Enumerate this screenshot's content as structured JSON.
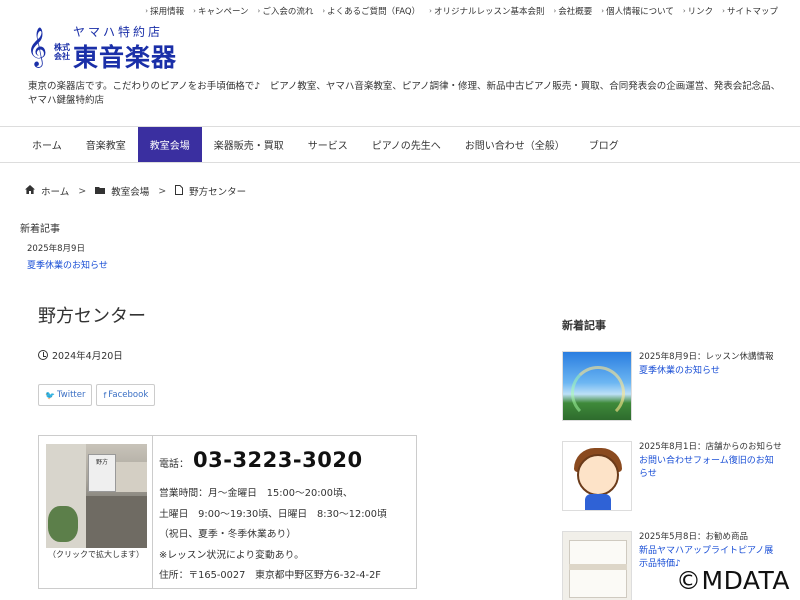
{
  "top_menu": [
    "採用情報",
    "キャンペーン",
    "ご入会の流れ",
    "よくあるご質問（FAQ）",
    "オリジナルレッスン基本会則",
    "会社概要",
    "個人情報について",
    "リンク",
    "サイトマップ"
  ],
  "logo": {
    "sub": "ヤマハ特約店",
    "corp_line1": "株式",
    "corp_line2": "会社",
    "name": "東音楽器"
  },
  "tagline": "東京の楽器店です。こだわりのピアノをお手頃価格で♪　ピアノ教室、ヤマハ音楽教室、ピアノ調律・修理、新品中古ピアノ販売・買取、合同発表会の企画運営、発表会記念品、ヤマハ鍵盤特約店",
  "nav": {
    "items": [
      "ホーム",
      "音楽教室",
      "教室会場",
      "楽器販売・買取",
      "サービス",
      "ピアノの先生へ",
      "お問い合わせ（全般）",
      "ブログ"
    ],
    "active": "教室会場"
  },
  "breadcrumb": {
    "home": "ホーム",
    "category": "教室会場",
    "current": "野方センター"
  },
  "new_articles_top": {
    "label": "新着記事",
    "date": "2025年8月9日",
    "title": "夏季休業のお知らせ"
  },
  "article": {
    "title": "野方センター",
    "date": "2024年4月20日",
    "share": {
      "twitter": "Twitter",
      "facebook": "Facebook"
    },
    "photo_sign": "野方",
    "caption": "（クリックで拡大します）",
    "phone_label": "電話：",
    "phone": "03-3223-3020",
    "lines": [
      "営業時間：月～金曜日　15:00～20:00頃、",
      "土曜日　9:00～19:30頃、日曜日　8:30～12:00頃",
      "（祝日、夏季・冬季休業あり）",
      "※レッスン状況により変動あり。",
      "住所：〒165-0027　東京都中野区野方6-32-4-2F"
    ]
  },
  "sidebar": {
    "heading": "新着記事",
    "items": [
      {
        "meta": "2025年8月9日：レッスン休講情報",
        "title": "夏季休業のお知らせ",
        "thumb": "sky-rainbow"
      },
      {
        "meta": "2025年8月1日：店舗からのお知らせ",
        "title": "お問い合わせフォーム復旧のお知らせ",
        "thumb": "girl-illustration"
      },
      {
        "meta": "2025年5月8日：お勧め商品",
        "title": "新品ヤマハアップライトピアノ展示品特価♪",
        "thumb": "white-piano"
      }
    ]
  },
  "watermark": "©MDATA",
  "colors": {
    "brand": "#1a2fa8",
    "nav_active": "#3a2fa0",
    "link": "#1a4fd6"
  }
}
